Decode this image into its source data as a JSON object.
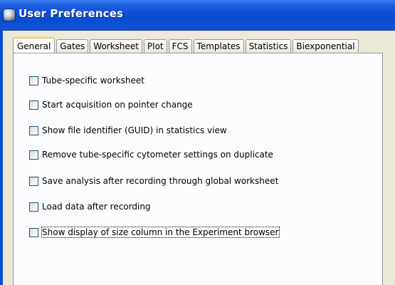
{
  "window": {
    "title": "User Preferences"
  },
  "tabs": [
    {
      "label": "General",
      "active": true
    },
    {
      "label": "Gates",
      "active": false
    },
    {
      "label": "Worksheet",
      "active": false
    },
    {
      "label": "Plot",
      "active": false
    },
    {
      "label": "FCS",
      "active": false
    },
    {
      "label": "Templates",
      "active": false
    },
    {
      "label": "Statistics",
      "active": false
    },
    {
      "label": "Biexponential",
      "active": false
    }
  ],
  "options": [
    {
      "label": "Tube-specific worksheet",
      "checked": false
    },
    {
      "label": "Start acquisition on pointer change",
      "checked": false
    },
    {
      "label": "Show file identifier (GUID) in statistics view",
      "checked": false
    },
    {
      "label": "Remove tube-specific cytometer settings on duplicate",
      "checked": false
    },
    {
      "label": "Save analysis after recording through global worksheet",
      "checked": false
    },
    {
      "label": "Load data after recording",
      "checked": false
    },
    {
      "label": "Show display of size column in the Experiment browser",
      "checked": false,
      "focused": true
    }
  ],
  "colors": {
    "titlebar": "#0a4ccf",
    "dialog_background": "#ece9d8",
    "panel_background": "#fcfcfe",
    "active_tab_accent": "#ffc83c",
    "checkbox_border": "#1c5180"
  }
}
